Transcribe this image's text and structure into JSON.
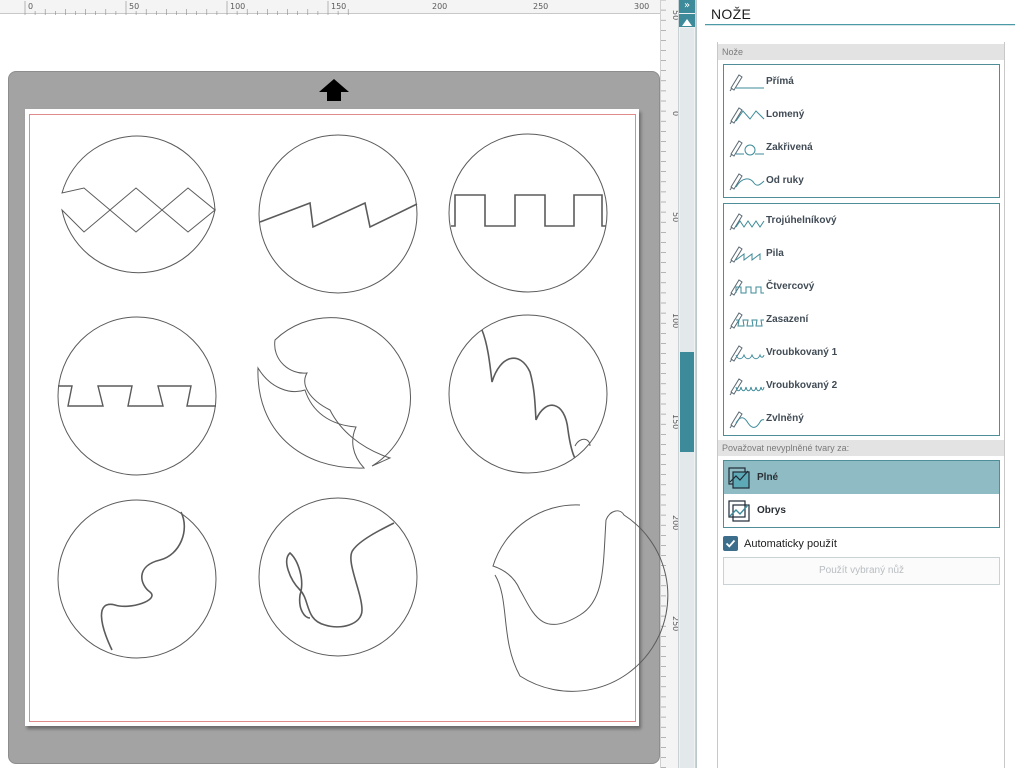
{
  "panel": {
    "title": "NOŽE",
    "knives_group_label": "Nože",
    "basic_knives": [
      {
        "label": "Přímá",
        "icon": "straight-knife-icon"
      },
      {
        "label": "Lomený",
        "icon": "broken-knife-icon"
      },
      {
        "label": "Zakřivená",
        "icon": "curved-knife-icon"
      },
      {
        "label": "Od ruky",
        "icon": "freehand-knife-icon"
      }
    ],
    "pattern_knives": [
      {
        "label": "Trojúhelníkový",
        "icon": "triangular-knife-icon"
      },
      {
        "label": "Pila",
        "icon": "saw-knife-icon"
      },
      {
        "label": "Čtvercový",
        "icon": "square-knife-icon"
      },
      {
        "label": "Zasazení",
        "icon": "notch-knife-icon"
      },
      {
        "label": "Vroubkovaný 1",
        "icon": "scallop1-knife-icon"
      },
      {
        "label": "Vroubkovaný 2",
        "icon": "scallop2-knife-icon"
      },
      {
        "label": "Zvlněný",
        "icon": "wavy-knife-icon"
      }
    ],
    "treat_label": "Považovat nevyplněné tvary za:",
    "treat_options": [
      {
        "label": "Plné",
        "selected": true
      },
      {
        "label": "Obrys",
        "selected": false
      }
    ],
    "auto_apply_label": "Automaticky použít",
    "auto_apply_checked": true,
    "apply_button_label": "Použít vybraný nůž"
  },
  "ruler": {
    "h_labels": [
      "0",
      "50",
      "100",
      "150",
      "200",
      "250",
      "300"
    ],
    "v_labels": [
      "50",
      "0",
      "50",
      "100",
      "150",
      "200",
      "250"
    ]
  },
  "colors": {
    "accent": "#3d8b9a",
    "selected_bg": "#8fbcc4",
    "mat": "#a3a3a3",
    "cut_line": "#e28b8b"
  }
}
